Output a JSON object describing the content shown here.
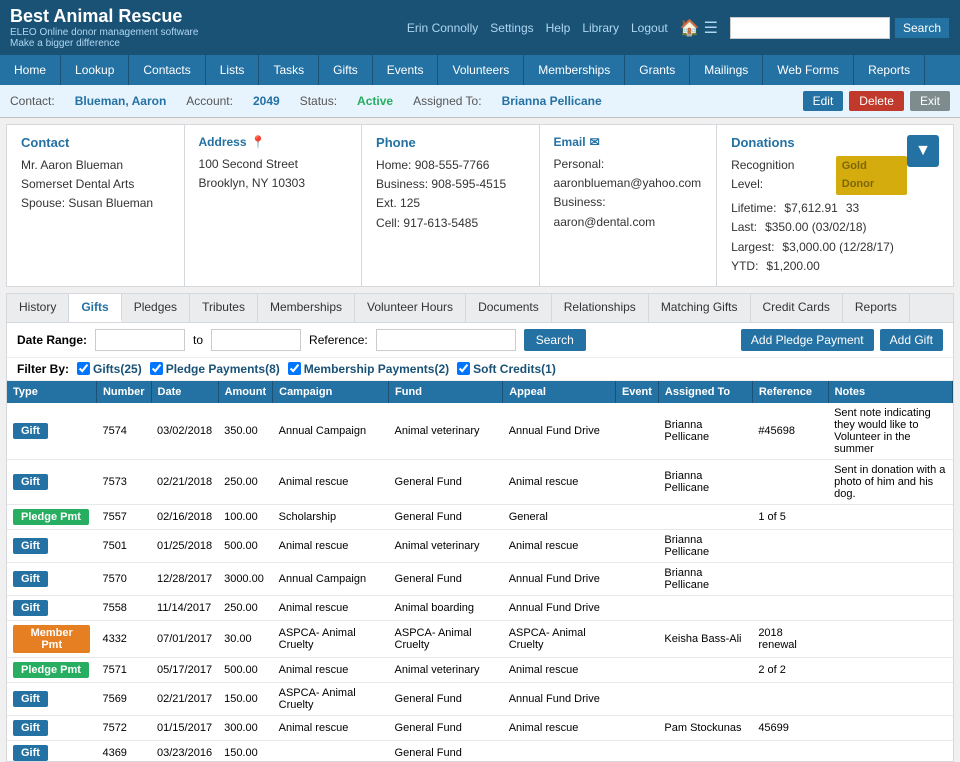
{
  "header": {
    "title": "Best Animal Rescue",
    "subtitle1": "ELEO Online donor management software",
    "subtitle2": "Make a bigger difference",
    "user": "Erin Connolly",
    "links": [
      "Settings",
      "Help",
      "Library",
      "Logout"
    ],
    "search_placeholder": "",
    "search_btn": "Search"
  },
  "nav": {
    "items": [
      "Home",
      "Lookup",
      "Contacts",
      "Lists",
      "Tasks",
      "Gifts",
      "Events",
      "Volunteers",
      "Memberships",
      "Grants",
      "Mailings",
      "Web Forms",
      "Reports"
    ]
  },
  "contact_bar": {
    "contact_label": "Contact:",
    "contact_value": "Blueman, Aaron",
    "account_label": "Account:",
    "account_value": "2049",
    "status_label": "Status:",
    "status_value": "Active",
    "assigned_label": "Assigned To:",
    "assigned_value": "Brianna Pellicane",
    "edit_btn": "Edit",
    "delete_btn": "Delete",
    "exit_btn": "Exit"
  },
  "info": {
    "contact": {
      "title": "Contact",
      "line1": "Mr. Aaron Blueman",
      "line2": "Somerset Dental Arts",
      "line3": "Spouse: Susan Blueman"
    },
    "address": {
      "title": "Address",
      "line1": "100 Second Street",
      "line2": "Brooklyn, NY 10303"
    },
    "phone": {
      "title": "Phone",
      "home_label": "Home:",
      "home_value": "908-555-7766",
      "business_label": "Business:",
      "business_value": "908-595-4515 Ext. 125",
      "cell_label": "Cell:",
      "cell_value": "917-613-5485"
    },
    "email": {
      "title": "Email",
      "personal_label": "Personal:",
      "personal_value": "aaronblueman@yahoo.com",
      "business_label": "Business:",
      "business_value": "aaron@dental.com"
    },
    "donations": {
      "title": "Donations",
      "recognition_label": "Recognition Level:",
      "recognition_value": "Gold Donor",
      "lifetime_label": "Lifetime:",
      "lifetime_value": "$7,612.91",
      "lifetime_count": "33",
      "last_label": "Last:",
      "last_value": "$350.00 (03/02/18)",
      "largest_label": "Largest:",
      "largest_value": "$3,000.00 (12/28/17)",
      "ytd_label": "YTD:",
      "ytd_value": "$1,200.00"
    }
  },
  "tabs": {
    "items": [
      "History",
      "Gifts",
      "Pledges",
      "Tributes",
      "Memberships",
      "Volunteer Hours",
      "Documents",
      "Relationships",
      "Matching Gifts",
      "Credit Cards",
      "Reports"
    ],
    "active": "Gifts"
  },
  "filters": {
    "date_range_label": "Date Range:",
    "to_label": "to",
    "reference_label": "Reference:",
    "search_btn": "Search",
    "add_pledge_btn": "Add Pledge Payment",
    "add_gift_btn": "Add Gift",
    "filter_label": "Filter By:",
    "checkboxes": [
      {
        "label": "Gifts(25)",
        "checked": true,
        "type": "gift"
      },
      {
        "label": "Pledge Payments(8)",
        "checked": true,
        "type": "pledge"
      },
      {
        "label": "Membership Payments(2)",
        "checked": true,
        "type": "membership"
      },
      {
        "label": "Soft Credits(1)",
        "checked": true,
        "type": "soft"
      }
    ]
  },
  "table": {
    "headers": [
      "Type",
      "Number",
      "Date",
      "Amount",
      "Campaign",
      "Fund",
      "Appeal",
      "Event",
      "Assigned To",
      "Reference",
      "Notes"
    ],
    "rows": [
      {
        "type": "Gift",
        "type_class": "type-gift",
        "number": "7574",
        "date": "03/02/2018",
        "amount": "350.00",
        "campaign": "Annual Campaign",
        "fund": "Animal veterinary",
        "appeal": "Annual Fund Drive",
        "event": "",
        "assigned_to": "Brianna Pellicane",
        "reference": "#45698",
        "notes": "Sent note indicating they would like to Volunteer in the summer"
      },
      {
        "type": "Gift",
        "type_class": "type-gift",
        "number": "7573",
        "date": "02/21/2018",
        "amount": "250.00",
        "campaign": "Animal rescue",
        "fund": "General Fund",
        "appeal": "Animal rescue",
        "event": "",
        "assigned_to": "Brianna Pellicane",
        "reference": "",
        "notes": "Sent in donation with a photo of him and his dog."
      },
      {
        "type": "Pledge Pmt",
        "type_class": "type-pledge",
        "number": "7557",
        "date": "02/16/2018",
        "amount": "100.00",
        "campaign": "Scholarship",
        "fund": "General Fund",
        "appeal": "General",
        "event": "",
        "assigned_to": "",
        "reference": "1 of 5",
        "notes": ""
      },
      {
        "type": "Gift",
        "type_class": "type-gift",
        "number": "7501",
        "date": "01/25/2018",
        "amount": "500.00",
        "campaign": "Animal rescue",
        "fund": "Animal veterinary",
        "appeal": "Animal rescue",
        "event": "",
        "assigned_to": "Brianna Pellicane",
        "reference": "",
        "notes": ""
      },
      {
        "type": "Gift",
        "type_class": "type-gift",
        "number": "7570",
        "date": "12/28/2017",
        "amount": "3000.00",
        "campaign": "Annual Campaign",
        "fund": "General Fund",
        "appeal": "Annual Fund Drive",
        "event": "",
        "assigned_to": "Brianna Pellicane",
        "reference": "",
        "notes": ""
      },
      {
        "type": "Gift",
        "type_class": "type-gift",
        "number": "7558",
        "date": "11/14/2017",
        "amount": "250.00",
        "campaign": "Animal rescue",
        "fund": "Animal boarding",
        "appeal": "Annual Fund Drive",
        "event": "",
        "assigned_to": "",
        "reference": "",
        "notes": ""
      },
      {
        "type": "Member Pmt",
        "type_class": "type-member",
        "number": "4332",
        "date": "07/01/2017",
        "amount": "30.00",
        "campaign": "ASPCA- Animal Cruelty",
        "fund": "ASPCA- Animal Cruelty",
        "appeal": "ASPCA- Animal Cruelty",
        "event": "",
        "assigned_to": "Keisha Bass-Ali",
        "reference": "2018 renewal",
        "notes": ""
      },
      {
        "type": "Pledge Pmt",
        "type_class": "type-pledge",
        "number": "7571",
        "date": "05/17/2017",
        "amount": "500.00",
        "campaign": "Animal rescue",
        "fund": "Animal veterinary",
        "appeal": "Animal rescue",
        "event": "",
        "assigned_to": "",
        "reference": "2 of 2",
        "notes": ""
      },
      {
        "type": "Gift",
        "type_class": "type-gift",
        "number": "7569",
        "date": "02/21/2017",
        "amount": "150.00",
        "campaign": "ASPCA- Animal Cruelty",
        "fund": "General Fund",
        "appeal": "Annual Fund Drive",
        "event": "",
        "assigned_to": "",
        "reference": "",
        "notes": ""
      },
      {
        "type": "Gift",
        "type_class": "type-gift",
        "number": "7572",
        "date": "01/15/2017",
        "amount": "300.00",
        "campaign": "Animal rescue",
        "fund": "General Fund",
        "appeal": "Animal rescue",
        "event": "",
        "assigned_to": "Pam Stockunas",
        "reference": "45699",
        "notes": ""
      },
      {
        "type": "Gift",
        "type_class": "type-gift",
        "number": "4369",
        "date": "03/23/2016",
        "amount": "150.00",
        "campaign": "",
        "fund": "General Fund",
        "appeal": "",
        "event": "",
        "assigned_to": "",
        "reference": "",
        "notes": ""
      }
    ]
  }
}
